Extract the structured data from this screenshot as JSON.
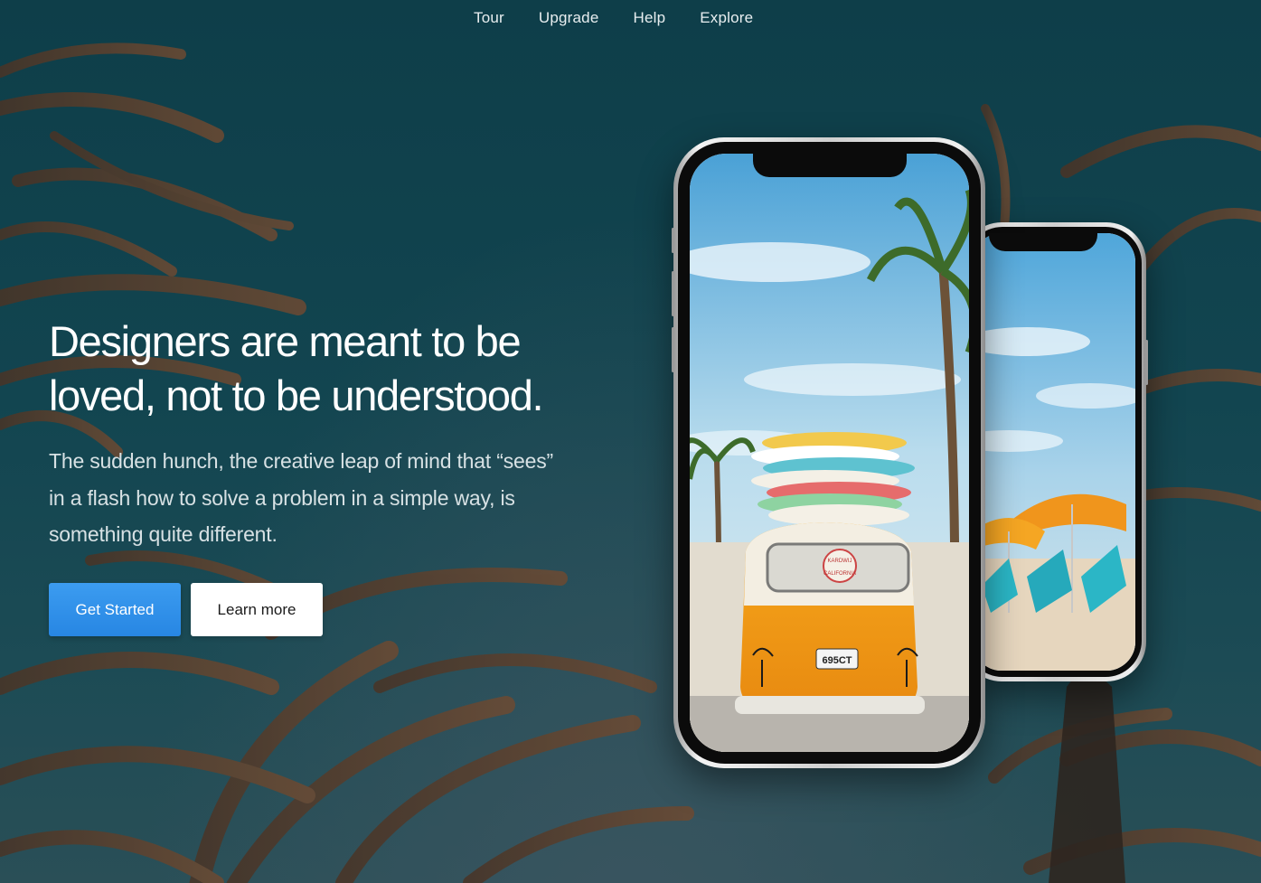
{
  "nav": {
    "items": [
      {
        "label": "Tour"
      },
      {
        "label": "Upgrade"
      },
      {
        "label": "Help"
      },
      {
        "label": "Explore"
      }
    ]
  },
  "hero": {
    "headline_line1": "Designers are meant to be",
    "headline_line2": "loved, not to be understood.",
    "lead_line1": "The sudden hunch, the creative leap of mind that “sees”",
    "lead_line2": "in a flash how to solve a problem in a simple way, is",
    "lead_line3": "something quite different.",
    "primary_button": "Get Started",
    "secondary_button": "Learn more"
  },
  "colors": {
    "background": "#0f3f4a",
    "primary_button": "#2f8fea",
    "secondary_button": "#ffffff",
    "text": "#ffffff"
  },
  "mockups": {
    "front_van_plate": "695CT",
    "front_van_sticker_top": "KARDWIJ",
    "front_van_sticker_bottom": "CALIFORNIA"
  }
}
